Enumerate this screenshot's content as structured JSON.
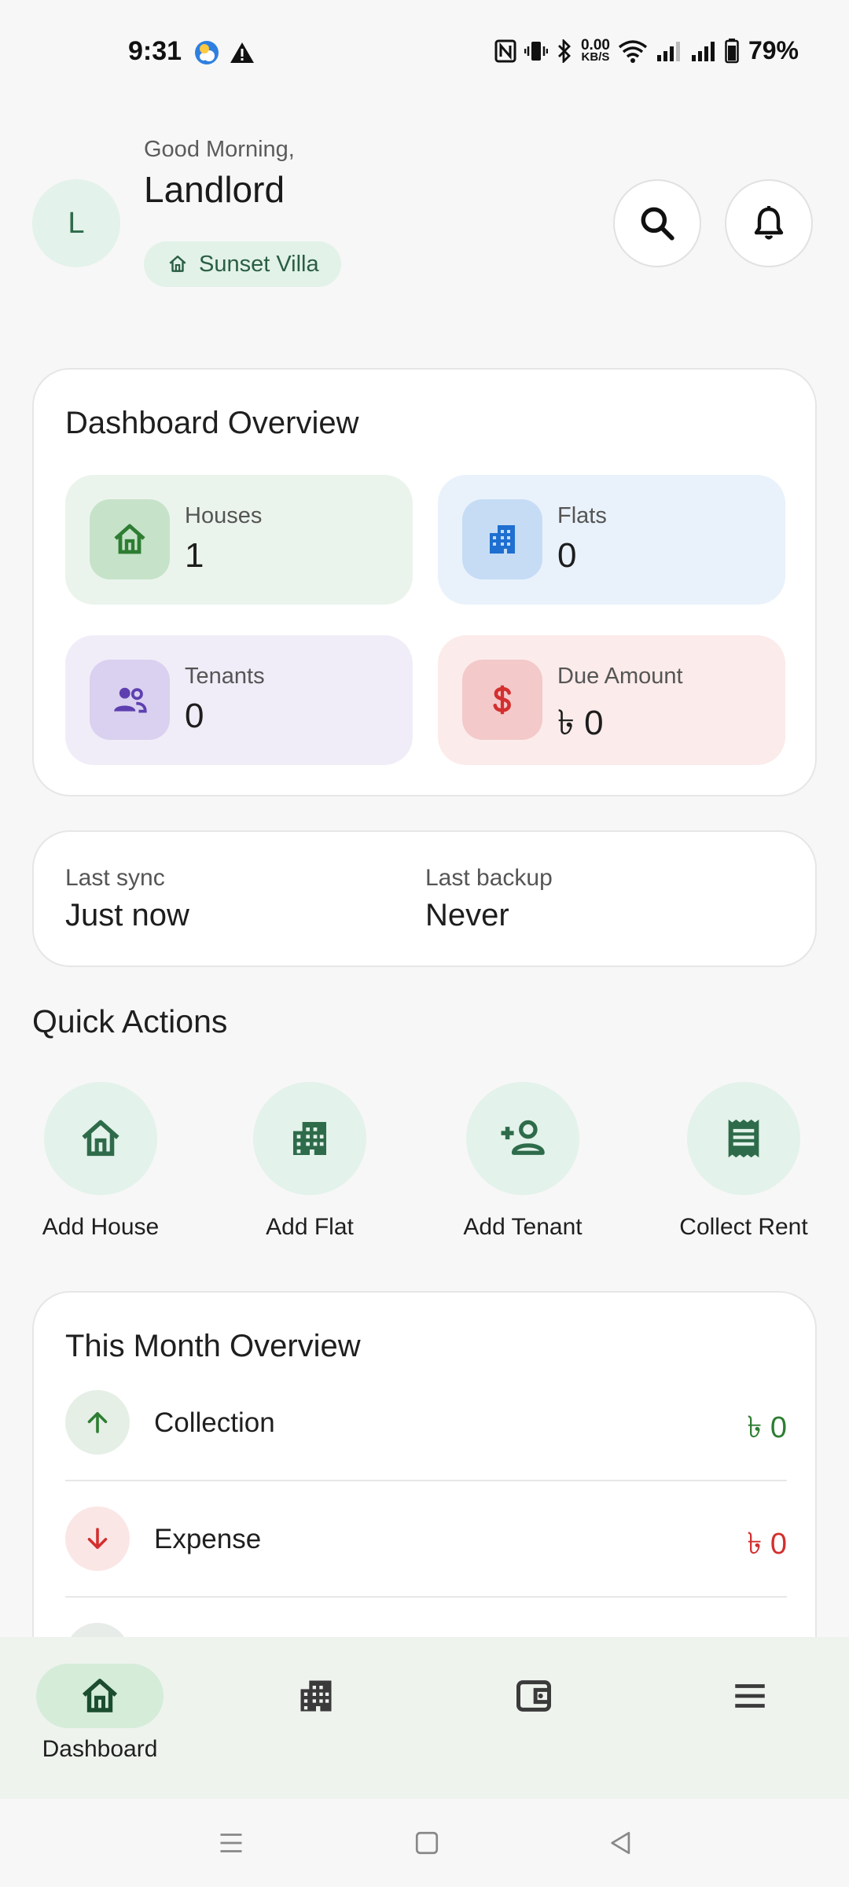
{
  "status_bar": {
    "time": "9:31",
    "net_speed_value": "0.00",
    "net_speed_unit": "KB/S",
    "battery": "79%"
  },
  "header": {
    "avatar_initial": "L",
    "greeting": "Good Morning,",
    "user_name": "Landlord",
    "property": "Sunset Villa"
  },
  "overview": {
    "title": "Dashboard Overview",
    "tiles": [
      {
        "label": "Houses",
        "value": "1",
        "icon": "home-icon",
        "color": "#2e7d32"
      },
      {
        "label": "Flats",
        "value": "0",
        "icon": "building-icon",
        "color": "#1e6fd0"
      },
      {
        "label": "Tenants",
        "value": "0",
        "icon": "people-icon",
        "color": "#5e3fb0"
      },
      {
        "label": "Due Amount",
        "value": "৳ 0",
        "icon": "dollar-icon",
        "color": "#d32f2f"
      }
    ]
  },
  "sync": {
    "last_sync_label": "Last sync",
    "last_sync_value": "Just now",
    "last_backup_label": "Last backup",
    "last_backup_value": "Never"
  },
  "quick_actions": {
    "title": "Quick Actions",
    "items": [
      {
        "label": "Add House",
        "icon": "home-icon"
      },
      {
        "label": "Add Flat",
        "icon": "building-icon"
      },
      {
        "label": "Add Tenant",
        "icon": "add-person-icon"
      },
      {
        "label": "Collect Rent",
        "icon": "receipt-icon"
      }
    ],
    "accent": "#2e6b4a"
  },
  "month_overview": {
    "title": "This Month Overview",
    "rows": [
      {
        "label": "Collection",
        "amount": "৳ 0",
        "icon": "arrow-up-icon",
        "color": "#2e7d32"
      },
      {
        "label": "Expense",
        "amount": "৳ 0",
        "icon": "arrow-down-icon",
        "color": "#d32f2f"
      }
    ]
  },
  "bottom_nav": {
    "items": [
      {
        "label": "Dashboard",
        "icon": "home-icon",
        "active": true
      },
      {
        "label": "",
        "icon": "building-icon",
        "active": false
      },
      {
        "label": "",
        "icon": "wallet-icon",
        "active": false
      },
      {
        "label": "",
        "icon": "menu-icon",
        "active": false
      }
    ]
  }
}
